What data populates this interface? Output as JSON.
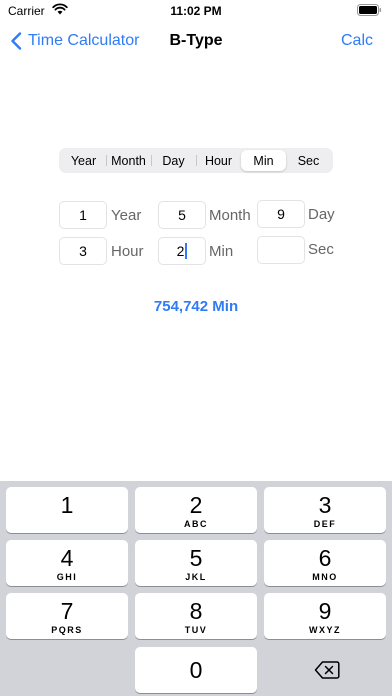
{
  "status_bar": {
    "carrier": "Carrier",
    "time": "11:02 PM"
  },
  "nav": {
    "back_label": "Time Calculator",
    "title": "B-Type",
    "action_label": "Calc"
  },
  "segments": {
    "items": [
      "Year",
      "Month",
      "Day",
      "Hour",
      "Min",
      "Sec"
    ],
    "selected": "Min"
  },
  "fields": {
    "year": {
      "value": "1",
      "unit": "Year"
    },
    "month": {
      "value": "5",
      "unit": "Month"
    },
    "day": {
      "value": "9",
      "unit": "Day"
    },
    "hour": {
      "value": "3",
      "unit": "Hour"
    },
    "min": {
      "value": "2",
      "unit": "Min"
    },
    "sec": {
      "value": "",
      "unit": "Sec"
    }
  },
  "result": "754,742 Min",
  "keyboard": {
    "keys": [
      {
        "num": "1",
        "letters": ""
      },
      {
        "num": "2",
        "letters": "ABC"
      },
      {
        "num": "3",
        "letters": "DEF"
      },
      {
        "num": "4",
        "letters": "GHI"
      },
      {
        "num": "5",
        "letters": "JKL"
      },
      {
        "num": "6",
        "letters": "MNO"
      },
      {
        "num": "7",
        "letters": "PQRS"
      },
      {
        "num": "8",
        "letters": "TUV"
      },
      {
        "num": "9",
        "letters": "WXYZ"
      },
      {
        "num": "0",
        "letters": ""
      }
    ],
    "delete_icon": "delete-backward-icon"
  },
  "colors": {
    "accent": "#2f7cf6",
    "keyboard_bg": "#d1d3d9"
  }
}
